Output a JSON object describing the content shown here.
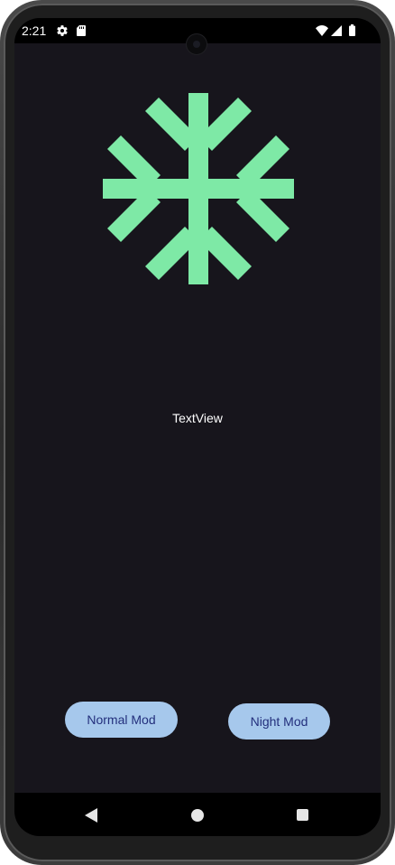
{
  "status_bar": {
    "time": "2:21",
    "icons": [
      "gear-icon",
      "sd-card-icon",
      "wifi-icon",
      "signal-icon",
      "battery-icon"
    ]
  },
  "main": {
    "image_icon": "snowflake-icon",
    "image_color": "#7ee9a6",
    "textview_label": "TextView"
  },
  "buttons": {
    "normal_mode_label": "Normal Mod",
    "night_mode_label": "Night Mod",
    "color": "#a6c8ec",
    "text_color": "#232f7c"
  },
  "nav_bar": {
    "icons": [
      "back-icon",
      "home-icon",
      "recents-icon"
    ]
  },
  "theme": {
    "background": "#17151c",
    "bars": "#000000"
  }
}
